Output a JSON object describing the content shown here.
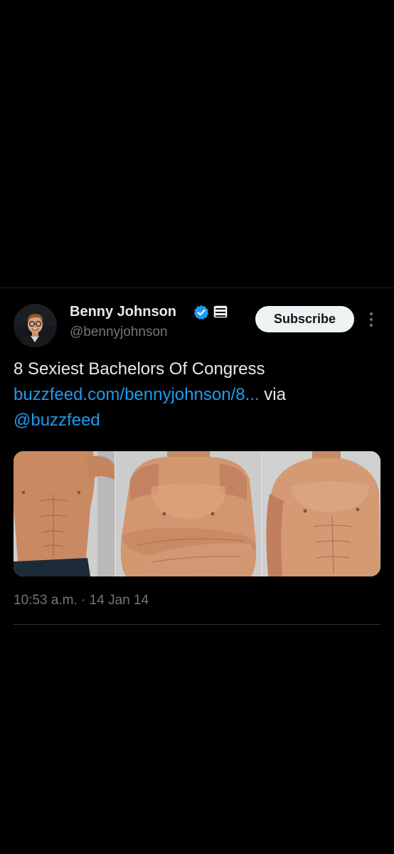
{
  "tweet": {
    "display_name": "Benny Johnson",
    "handle": "@bennyjohnson",
    "subscribe_label": "Subscribe",
    "text_line1": "8 Sexiest Bachelors Of Congress",
    "link_text": "buzzfeed.com/bennyjohnson/8...",
    "via_text": " via",
    "mention": "@buzzfeed",
    "timestamp": "10:53 a.m. · 14 Jan 14",
    "icons": {
      "verified": "verified-badge-icon",
      "affiliate": "affiliate-badge-icon",
      "more": "more-options-icon"
    },
    "media": {
      "count": 3,
      "description_items": [
        "photo-1",
        "photo-2",
        "photo-3"
      ]
    }
  },
  "colors": {
    "background": "#000000",
    "primary_text": "#e7e9ea",
    "secondary_text": "#71767b",
    "link": "#1d9bf0",
    "verified": "#1d9bf0",
    "button_bg": "#eff3f4"
  }
}
